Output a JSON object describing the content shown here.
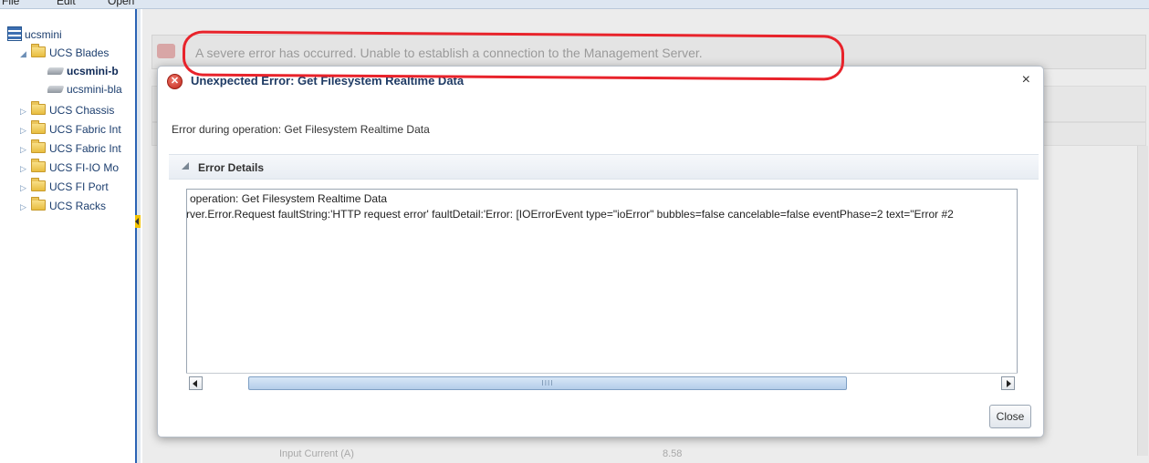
{
  "menubar": {
    "items": [
      "File",
      "Edit",
      "Open"
    ]
  },
  "tree": {
    "root": "ucsmini",
    "items": [
      {
        "label": "UCS Blades",
        "expanded": true,
        "icon": "folder-icon"
      },
      {
        "label": "ucsmini-b",
        "icon": "blade-server-icon",
        "selected": true
      },
      {
        "label": "ucsmini-bla",
        "icon": "blade-server-icon"
      },
      {
        "label": "UCS Chassis",
        "icon": "folder-icon"
      },
      {
        "label": "UCS Fabric Int",
        "icon": "folder-icon"
      },
      {
        "label": "UCS Fabric Int",
        "icon": "folder-icon"
      },
      {
        "label": "UCS FI-IO Mo",
        "icon": "folder-icon"
      },
      {
        "label": "UCS FI Port",
        "icon": "folder-icon"
      },
      {
        "label": "UCS Racks",
        "icon": "folder-icon"
      }
    ]
  },
  "background": {
    "banner": "A severe error has occurred. Unable to establish a connection to the Management Server.",
    "row_label": "Input Current (A)",
    "row_value": "8.58"
  },
  "dialog": {
    "title": "Unexpected Error: Get Filesystem Realtime Data",
    "close_symbol": "×",
    "message": "Error during operation: Get Filesystem Realtime Data",
    "details_header": "Error Details",
    "details_lines": [
      "operation: Get Filesystem Realtime Data",
      "rver.Error.Request faultString:'HTTP request error' faultDetail:'Error: [IOErrorEvent type=\"ioError\" bubbles=false cancelable=false eventPhase=2 text=\"Error #2"
    ],
    "scroll_thumb_grip": "IIII",
    "close_button": "Close"
  },
  "colors": {
    "annotation": "#e8232b",
    "title": "#1f3b64",
    "accent": "#2b63b4"
  }
}
